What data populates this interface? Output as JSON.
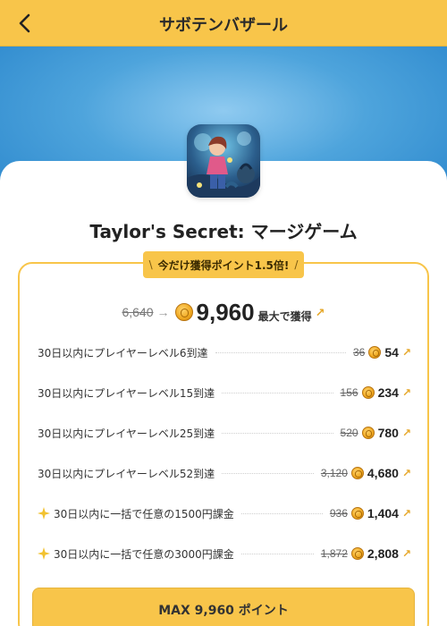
{
  "header": {
    "title": "サボテンバザール"
  },
  "app": {
    "title": "Taylor's Secret: マージゲーム"
  },
  "promo": {
    "badge_text": "今だけ獲得ポイント1.5倍!",
    "slash_left": "\\",
    "slash_right": "/"
  },
  "reward": {
    "old_total": "6,640",
    "new_total": "9,960",
    "label": "最大で獲得"
  },
  "tasks": [
    {
      "label": "30日以内にプレイヤーレベル6到達",
      "old": "36",
      "new": "54",
      "sparkle": false
    },
    {
      "label": "30日以内にプレイヤーレベル15到達",
      "old": "156",
      "new": "234",
      "sparkle": false
    },
    {
      "label": "30日以内にプレイヤーレベル25到達",
      "old": "520",
      "new": "780",
      "sparkle": false
    },
    {
      "label": "30日以内にプレイヤーレベル52到達",
      "old": "3,120",
      "new": "4,680",
      "sparkle": false
    },
    {
      "label": "30日以内に一括で任意の1500円課金",
      "old": "936",
      "new": "1,404",
      "sparkle": true
    },
    {
      "label": "30日以内に一括で任意の3000円課金",
      "old": "1,872",
      "new": "2,808",
      "sparkle": true
    }
  ],
  "cta": {
    "label": "MAX 9,960 ポイント"
  },
  "icons": {
    "back": "chevron-left-icon",
    "coin": "coin-icon",
    "sparkle": "sparkle-icon",
    "trend": "arrow-up-right-icon"
  },
  "colors": {
    "accent": "#f8c54a",
    "hero": "#4ea4dc"
  }
}
